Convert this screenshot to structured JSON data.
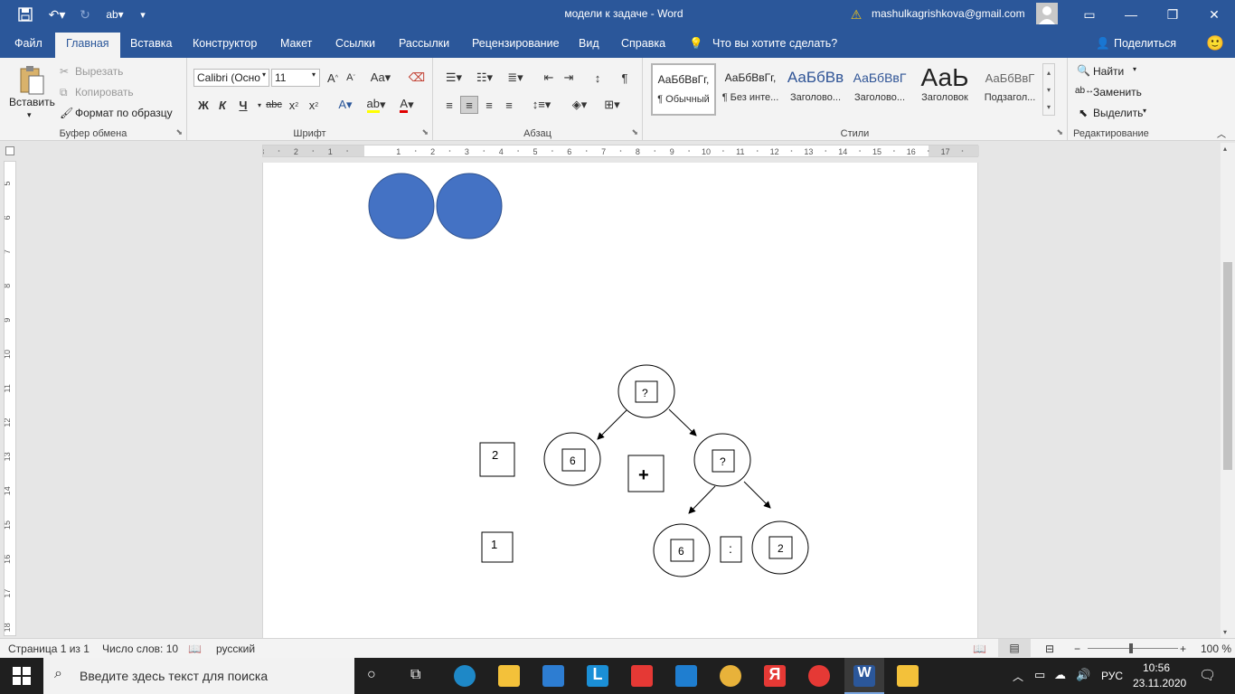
{
  "window": {
    "title": "модели к задаче  -  Word",
    "account": "mashulkagrishkova@gmail.com"
  },
  "ribbon_tabs": [
    "Файл",
    "Главная",
    "Вставка",
    "Конструктор",
    "Макет",
    "Ссылки",
    "Рассылки",
    "Рецензирование",
    "Вид",
    "Справка"
  ],
  "tell_me": "Что вы хотите сделать?",
  "share": "Поделиться",
  "clipboard": {
    "paste": "Вставить",
    "cut": "Вырезать",
    "copy": "Копировать",
    "format_painter": "Формат по образцу",
    "label": "Буфер обмена"
  },
  "font": {
    "name": "Calibri (Осно",
    "size": "11",
    "label": "Шрифт",
    "bold": "Ж",
    "italic": "К",
    "underline": "Ч",
    "strike": "abc"
  },
  "paragraph": {
    "label": "Абзац"
  },
  "styles": {
    "label": "Стили",
    "items": [
      {
        "preview": "АаБбВвГг,",
        "name": "¶ Обычный"
      },
      {
        "preview": "АаБбВвГг,",
        "name": "¶ Без инте..."
      },
      {
        "preview": "АаБбВв",
        "name": "Заголово..."
      },
      {
        "preview": "АаБбВвГ",
        "name": "Заголово..."
      },
      {
        "preview": "АаЬ",
        "name": "Заголовок"
      },
      {
        "preview": "АаБбВвГ",
        "name": "Подзагол..."
      }
    ]
  },
  "editing": {
    "label": "Редактирование",
    "find": "Найти",
    "replace": "Заменить",
    "select": "Выделить"
  },
  "ruler": {
    "h_ticks": [
      "3",
      "2",
      "1",
      "1",
      "2",
      "3",
      "4",
      "5",
      "6",
      "7",
      "8",
      "9",
      "10",
      "11",
      "12",
      "13",
      "14",
      "15",
      "16",
      "17"
    ],
    "v_ticks": [
      "5",
      "6",
      "7",
      "8",
      "9",
      "10",
      "11",
      "12",
      "13",
      "14",
      "15",
      "16",
      "17",
      "18"
    ]
  },
  "document": {
    "boxes": {
      "left_top": "2",
      "left_bottom": "1",
      "plus": "+",
      "colon": ":"
    },
    "tree": {
      "root": "?",
      "left": "6",
      "right": "?",
      "right_left": "6",
      "right_right": "2"
    },
    "fill_color": "#4472c4"
  },
  "status": {
    "page": "Страница 1 из 1",
    "words": "Число слов: 10",
    "lang": "русский",
    "zoom": "100 %"
  },
  "taskbar": {
    "search_placeholder": "Введите здесь текст для поиска",
    "lang": "РУС",
    "time": "10:56",
    "date": "23.11.2020"
  },
  "colors": {
    "word_blue": "#2b579a",
    "ribbon_bg": "#f3f3f3",
    "taskbar_bg": "#1f1f1f"
  }
}
